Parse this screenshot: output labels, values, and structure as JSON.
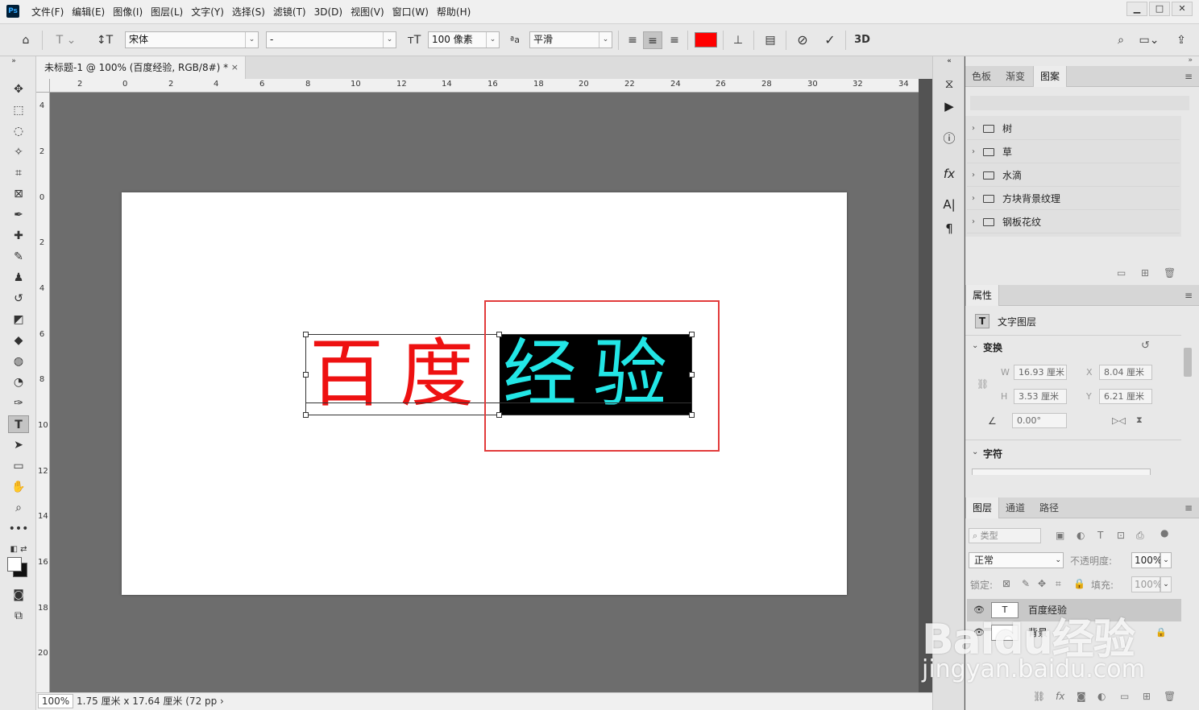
{
  "app": {
    "logo": "Ps"
  },
  "menu": [
    "文件(F)",
    "编辑(E)",
    "图像(I)",
    "图层(L)",
    "文字(Y)",
    "选择(S)",
    "滤镜(T)",
    "3D(D)",
    "视图(V)",
    "窗口(W)",
    "帮助(H)"
  ],
  "window_controls": {
    "minimize": "▁",
    "restore": "□",
    "close": "✕"
  },
  "options": {
    "font_family": "宋体",
    "font_style": "-",
    "font_size": "100 像素",
    "anti_alias_label": "ªa",
    "anti_alias": "平滑",
    "text_color": "#ff0000",
    "commit_label": "3D"
  },
  "document": {
    "tab_title": "未标题-1 @ 100% (百度经验, RGB/8#) *",
    "tab_close": "×",
    "text_red": "百度",
    "text_cyan": "经验",
    "red_color": "#ee1111",
    "cyan_color": "#22e6e6",
    "annotation_color": "#e23b3b"
  },
  "rulers": {
    "top": [
      "2",
      "0",
      "2",
      "4",
      "6",
      "8",
      "10",
      "12",
      "14",
      "16",
      "18",
      "20",
      "22",
      "24",
      "26",
      "28",
      "30",
      "32",
      "34"
    ],
    "left": [
      "4",
      "2",
      "0",
      "2",
      "4",
      "6",
      "8",
      "10",
      "12",
      "14",
      "16",
      "18",
      "20"
    ]
  },
  "status": {
    "zoom": "100%",
    "info": "1.75 厘米 x 17.64 厘米 (72 pp ›"
  },
  "patterns_panel": {
    "tabs": [
      "色板",
      "渐变",
      "图案"
    ],
    "items": [
      "树",
      "草",
      "水滴",
      "方块背景纹理",
      "钢板花纹"
    ]
  },
  "properties_panel": {
    "tab": "属性",
    "layer_type": "文字图层",
    "transform_head": "变换",
    "w_label": "W",
    "w_value": "16.93 厘米",
    "x_label": "X",
    "x_value": "8.04 厘米",
    "h_label": "H",
    "h_value": "3.53 厘米",
    "y_label": "Y",
    "y_value": "6.21 厘米",
    "angle_value": "0.00°",
    "char_head": "字符"
  },
  "layers_panel": {
    "tabs": [
      "图层",
      "通道",
      "路径"
    ],
    "filter_type": "类型",
    "blend_mode": "正常",
    "opacity_label": "不透明度:",
    "opacity_value": "100%",
    "lock_label": "锁定:",
    "fill_label": "填充:",
    "fill_value": "100%",
    "layers": [
      {
        "name": "百度经验",
        "thumb": "T"
      },
      {
        "name": "背景",
        "thumb": ""
      }
    ]
  },
  "watermark": {
    "logo": "Baidu经验",
    "url": "jingyan.baidu.com"
  }
}
